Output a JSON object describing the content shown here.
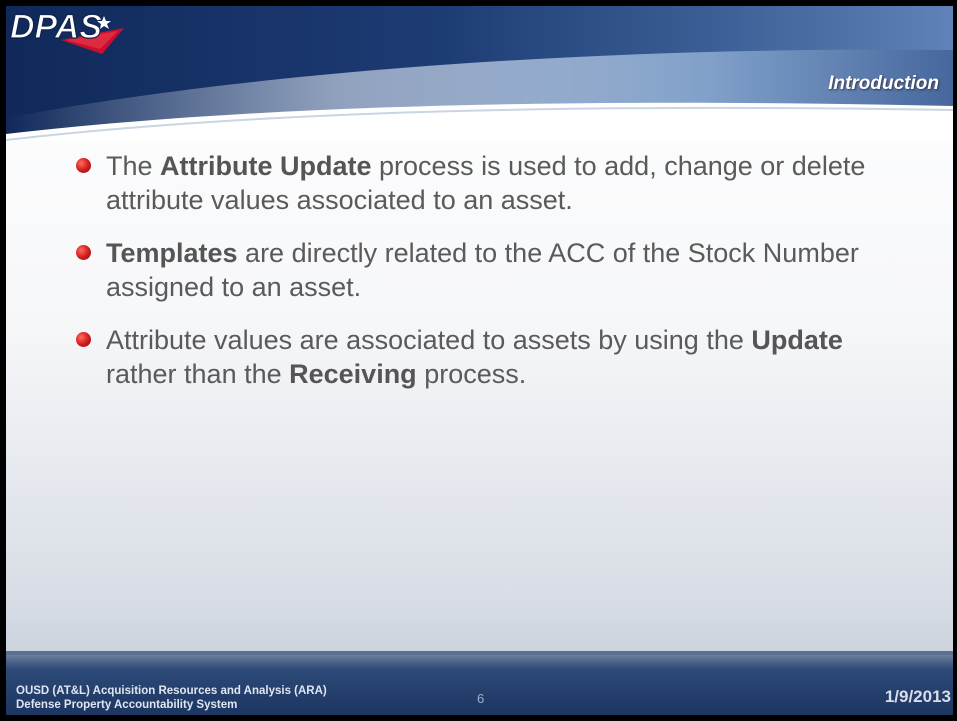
{
  "header": {
    "logo_text": "DPAS",
    "section_title": "Introduction"
  },
  "bullets": [
    {
      "parts": [
        "The ",
        "Attribute Update",
        " process is used to add, change or delete attribute values associated to an asset."
      ]
    },
    {
      "parts": [
        "Templates",
        " are directly related to the ACC of the Stock Number assigned to an asset."
      ]
    },
    {
      "parts": [
        "Attribute values are associated to assets by using the ",
        "Update",
        " rather than the ",
        "Receiving",
        " process."
      ]
    }
  ],
  "footer": {
    "org_line1": "OUSD (AT&L) Acquisition Resources and Analysis (ARA)",
    "org_line2": "Defense Property Accountability System",
    "page_number": "6",
    "date": "1/9/2013"
  },
  "colors": {
    "header_blue": "#1f3a6e",
    "bullet_red": "#d21f1f",
    "text_gray": "#5a5a5a"
  }
}
